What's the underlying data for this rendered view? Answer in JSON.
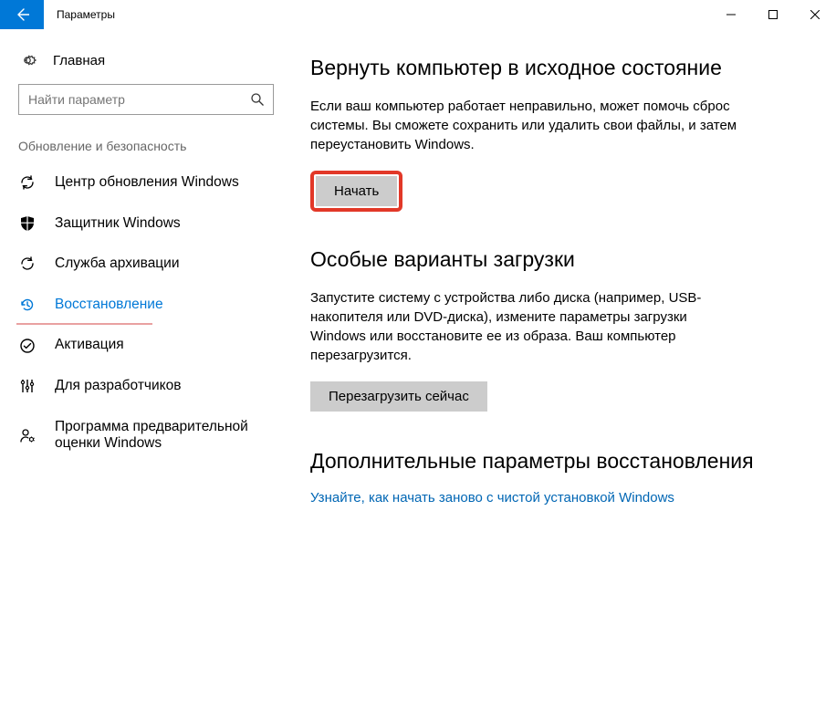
{
  "titlebar": {
    "title": "Параметры"
  },
  "sidebar": {
    "home": "Главная",
    "search_placeholder": "Найти параметр",
    "group": "Обновление и безопасность",
    "items": [
      {
        "label": "Центр обновления Windows"
      },
      {
        "label": "Защитник Windows"
      },
      {
        "label": "Служба архивации"
      },
      {
        "label": "Восстановление"
      },
      {
        "label": "Активация"
      },
      {
        "label": "Для разработчиков"
      },
      {
        "label": "Программа предварительной оценки Windows"
      }
    ]
  },
  "main": {
    "reset": {
      "heading": "Вернуть компьютер в исходное состояние",
      "body": "Если ваш компьютер работает неправильно, может помочь сброс системы. Вы сможете сохранить или удалить свои файлы, и затем переустановить Windows.",
      "button": "Начать"
    },
    "advanced_startup": {
      "heading": "Особые варианты загрузки",
      "body": "Запустите систему с устройства либо диска (например, USB-накопителя или DVD-диска), измените параметры загрузки Windows или восстановите ее из образа. Ваш компьютер перезагрузится.",
      "button": "Перезагрузить сейчас"
    },
    "more": {
      "heading": "Дополнительные параметры восстановления",
      "link": "Узнайте, как начать заново с чистой установкой Windows"
    }
  }
}
